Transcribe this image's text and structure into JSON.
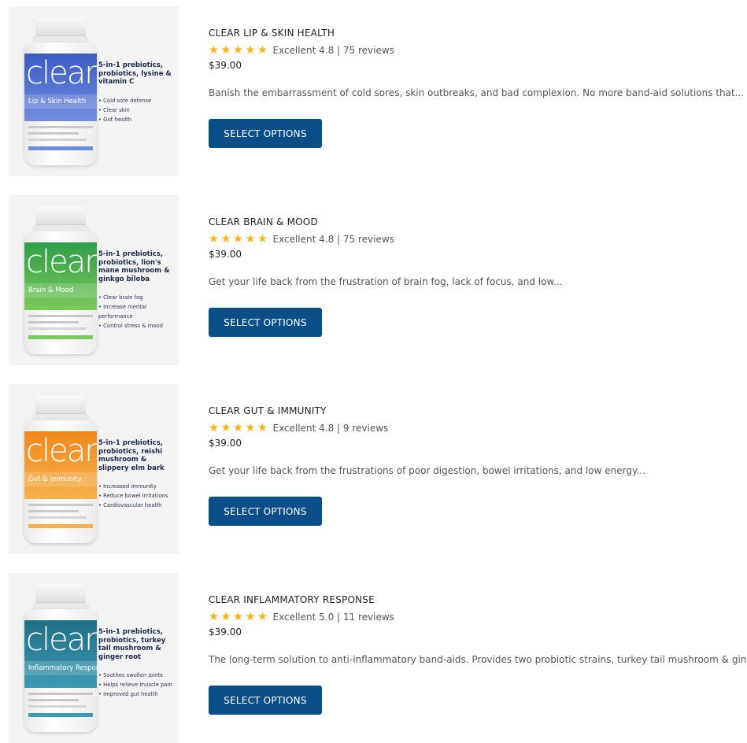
{
  "products": [
    {
      "title": "CLEAR LIP & SKIN HEALTH",
      "rating_text": "Excellent 4.8 | 75 reviews",
      "stars": 5,
      "price": "$39.00",
      "description": "Banish the embarrassment of cold sores, skin outbreaks, and bad complexion. No more band-aid solutions that...",
      "button": "SELECT OPTIONS",
      "image": {
        "brand": "clear",
        "variant": "Lip & Skin Health",
        "headline": "5-in-1 prebiotics, probiotics, lysine & vitamin C",
        "bullets": [
          "Cold sore defense",
          "Clear skin",
          "Gut health"
        ],
        "color": "#3b5bc2",
        "color2": "#6f8de0"
      }
    },
    {
      "title": "CLEAR BRAIN & MOOD",
      "rating_text": "Excellent 4.8 | 75 reviews",
      "stars": 5,
      "price": "$39.00",
      "description": "Get your life back from the frustration of brain fog, lack of focus, and low...",
      "button": "SELECT OPTIONS",
      "image": {
        "brand": "clear",
        "variant": "Brain & Mood",
        "headline": "5-in-1 prebiotics, probiotics, lion's mane mushroom & ginkgo biloba",
        "bullets": [
          "Clear brain fog",
          "Increase mental performance",
          "Control stress & mood"
        ],
        "color": "#2e9e4a",
        "color2": "#7bc95a"
      }
    },
    {
      "title": "CLEAR GUT & IMMUNITY",
      "rating_text": "Excellent 4.8 | 9 reviews",
      "stars": 5,
      "price": "$39.00",
      "description": "Get your life back from the frustrations of poor digestion, bowel irritations, and low energy...",
      "button": "SELECT OPTIONS",
      "image": {
        "brand": "clear",
        "variant": "Gut & Immunity",
        "headline": "5-in-1 prebiotics, probiotics, reishi mushroom & slippery elm bark",
        "bullets": [
          "Increased immunity",
          "Reduce bowel irritations",
          "Cardiovascular health"
        ],
        "color": "#f0891e",
        "color2": "#f6b04a"
      }
    },
    {
      "title": "CLEAR INFLAMMATORY RESPONSE",
      "rating_text": "Excellent 5.0 | 11 reviews",
      "stars": 5,
      "price": "$39.00",
      "description": "The long-term solution to anti-inflammatory band-aids. Provides two probiotic strains, turkey tail mushroom & ginger...",
      "button": "SELECT OPTIONS",
      "image": {
        "brand": "clear",
        "variant": "Inflammatory Response",
        "headline": "5-in-1 prebiotics, probiotics, turkey tail mushroom & ginger root",
        "bullets": [
          "Soothes swollen joints",
          "Helps relieve muscle pain",
          "Improved gut health"
        ],
        "color": "#1f6f86",
        "color2": "#3a9bb3"
      }
    }
  ]
}
